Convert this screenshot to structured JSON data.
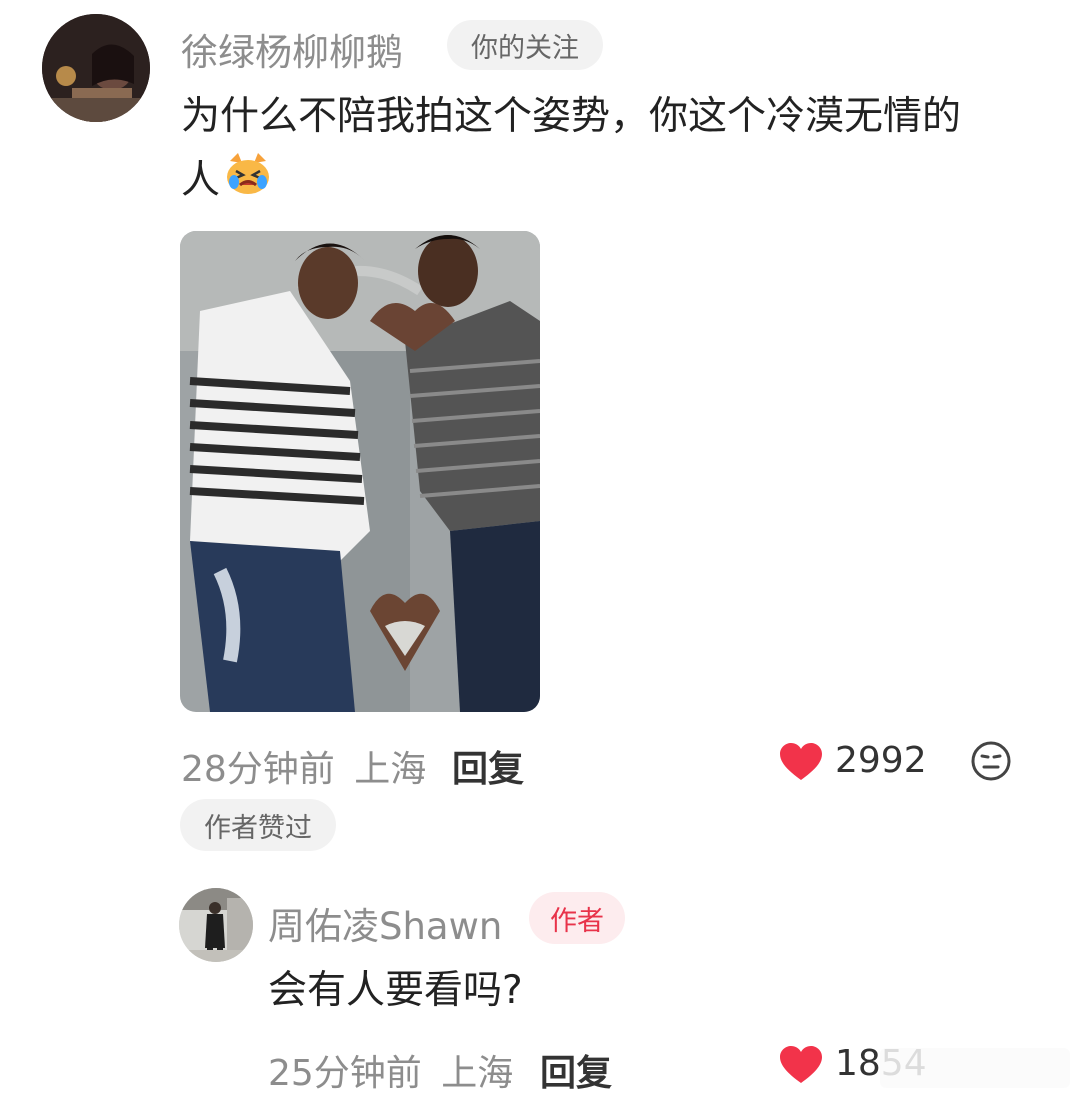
{
  "comment1": {
    "username": "徐绿杨柳柳鹅",
    "tag": "你的关注",
    "text_line1": "为什么不陪我拍这个姿势，你这个冷漠无情的",
    "text_line2": "人",
    "emoji": "crying-cat-emoji",
    "time": "28分钟前",
    "location": "上海",
    "reply_label": "回复",
    "likes": "2992",
    "liked_badge": "作者赞过"
  },
  "reply1": {
    "username": "周佑凌Shawn",
    "tag": "作者",
    "text": "会有人要看吗?",
    "time": "25分钟前",
    "location": "上海",
    "reply_label": "回复",
    "likes": "1854"
  },
  "colors": {
    "heart": "#f2334a",
    "author_tag_bg": "#fdecee",
    "author_tag_text": "#e8334a"
  }
}
